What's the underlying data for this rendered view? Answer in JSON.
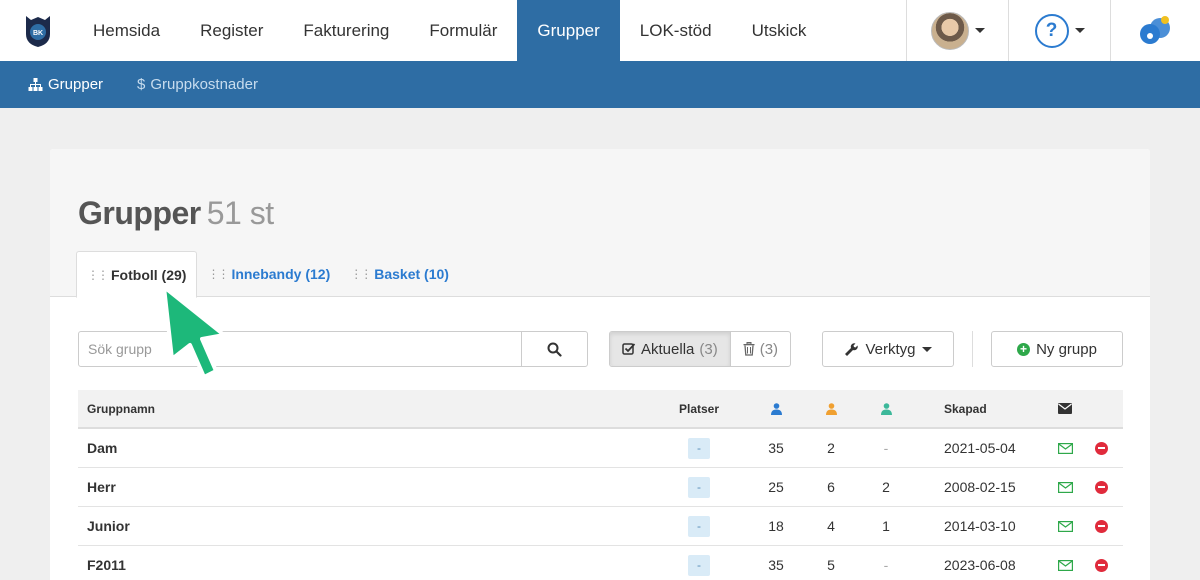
{
  "topnav": {
    "logo_icon": "club-shield-logo",
    "items": [
      {
        "label": "Hemsida"
      },
      {
        "label": "Register"
      },
      {
        "label": "Fakturering"
      },
      {
        "label": "Formulär"
      },
      {
        "label": "Grupper",
        "active": true
      },
      {
        "label": "LOK-stöd"
      },
      {
        "label": "Utskick"
      }
    ],
    "help_label": "?"
  },
  "subnav": {
    "items": [
      {
        "label": "Grupper",
        "icon": "sitemap-icon"
      },
      {
        "label": "Gruppkostnader",
        "icon": "dollar-icon"
      }
    ]
  },
  "page": {
    "title": "Grupper",
    "count": "51 st"
  },
  "tabs": [
    {
      "label": "Fotboll (29)",
      "active": true
    },
    {
      "label": "Innebandy (12)"
    },
    {
      "label": "Basket (10)"
    }
  ],
  "toolbar": {
    "search_placeholder": "Sök grupp",
    "current_label": "Aktuella",
    "current_count": "(3)",
    "trash_count": "(3)",
    "tools_label": "Verktyg",
    "new_label": "Ny grupp"
  },
  "table": {
    "headers": {
      "name": "Gruppnamn",
      "places": "Platser",
      "created": "Skapad"
    },
    "rows": [
      {
        "name": "Dam",
        "places": "-",
        "m1": "35",
        "m2": "2",
        "m3": "-",
        "created": "2021-05-04"
      },
      {
        "name": "Herr",
        "places": "-",
        "m1": "25",
        "m2": "6",
        "m3": "2",
        "created": "2008-02-15"
      },
      {
        "name": "Junior",
        "places": "-",
        "m1": "18",
        "m2": "4",
        "m3": "1",
        "created": "2014-03-10"
      },
      {
        "name": "F2011",
        "places": "-",
        "m1": "35",
        "m2": "5",
        "m3": "-",
        "created": "2023-06-08"
      }
    ]
  },
  "colors": {
    "primary": "#2e6da4",
    "link": "#2b7bd0",
    "member_blue": "#2b7bd0",
    "member_orange": "#f0a030",
    "member_teal": "#3cb89a",
    "success": "#2ea84a",
    "danger": "#e02b3c",
    "cursor": "#1db87a"
  }
}
